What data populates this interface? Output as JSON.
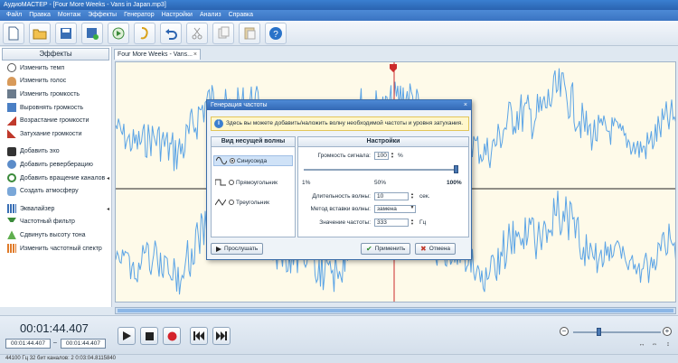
{
  "window": {
    "title": "АудиоМАСТЕР - [Four More Weeks - Vans in Japan.mp3]"
  },
  "menu": [
    "Файл",
    "Правка",
    "Монтаж",
    "Эффекты",
    "Генератор",
    "Настройки",
    "Анализ",
    "Справка"
  ],
  "toolbar": {
    "icons": [
      "new-file-icon",
      "open-folder-icon",
      "save-icon",
      "save-as-icon",
      "record-icon",
      "play-from-icon",
      "undo-icon",
      "cut-icon",
      "copy-icon",
      "paste-icon",
      "help-icon"
    ]
  },
  "sidebar": {
    "title": "Эффекты",
    "items": [
      "Изменить темп",
      "Изменить голос",
      "Изменить громкость",
      "Выровнять громкость",
      "Возрастание громкости",
      "Затухание громкости",
      "Добавить эхо",
      "Добавить реверберацию",
      "Добавить вращение каналов",
      "Создать атмосферу",
      "Эквалайзер",
      "Частотный фильтр",
      "Сдвинуть высоту тона",
      "Изменить частотный спектр"
    ]
  },
  "tab": {
    "label": "Four More Weeks - Vans...",
    "close": "×"
  },
  "time": {
    "current": "00:01:44.407",
    "sel_start": "00:01:44.407",
    "dash": "–",
    "sel_end": "00:01:44.407"
  },
  "status": {
    "text": "44100 Гц  32 бит  каналов: 2   0:03:04.8115840"
  },
  "zoom": {
    "minus": "−",
    "plus": "+"
  },
  "dialog": {
    "title": "Генерация частоты",
    "close": "×",
    "info": "Здесь вы можете добавить/наложить волну необходимой частоты и уровня затухания.",
    "wave_panel_title": "Вид несущей волны",
    "waves": [
      "Синусоида",
      "Прямоугольник",
      "Треугольник"
    ],
    "settings_title": "Настройки",
    "volume_label": "Громкость сигнала:",
    "volume_value": "100",
    "volume_unit": "%",
    "scale": [
      "1%",
      "50%",
      "100%"
    ],
    "duration_label": "Длительность волны:",
    "duration_value": "10",
    "duration_unit": "сек.",
    "method_label": "Метод вставки волны:",
    "method_value": "замена",
    "freq_label": "Значение частоты:",
    "freq_value": "333",
    "freq_unit": "Гц",
    "listen": "Прослушать",
    "apply": "Применить",
    "cancel": "Отмена"
  },
  "colors": {
    "accent": "#3a7fd0",
    "wave": "#5ba4e6",
    "wave_bg": "#fefae9",
    "cursor": "#cc2b2b"
  }
}
